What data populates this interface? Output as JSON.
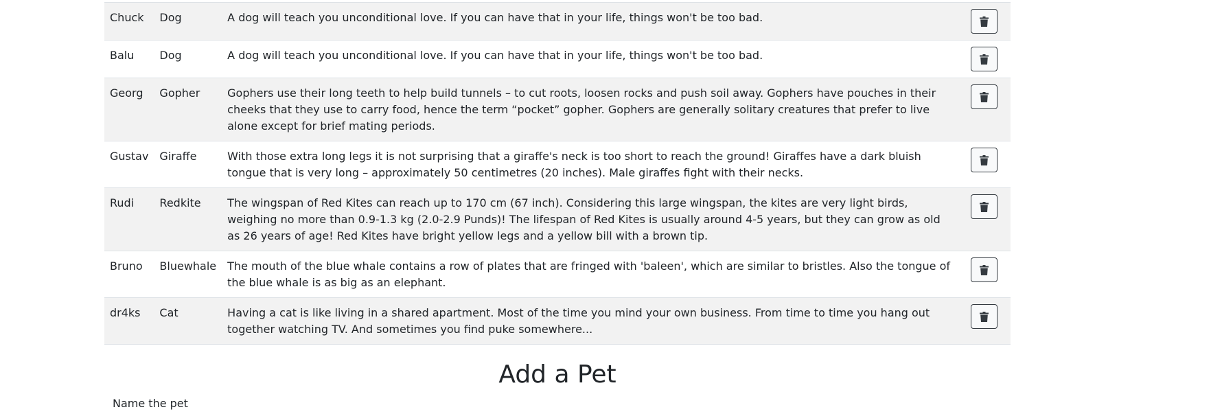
{
  "pets": [
    {
      "name": "Chuck",
      "type": "Dog",
      "description": "A dog will teach you unconditional love. If you can have that in your life, things won't be too bad."
    },
    {
      "name": "Balu",
      "type": "Dog",
      "description": "A dog will teach you unconditional love. If you can have that in your life, things won't be too bad."
    },
    {
      "name": "Georg",
      "type": "Gopher",
      "description": "Gophers use their long teeth to help build tunnels – to cut roots, loosen rocks and push soil away. Gophers have pouches in their cheeks that they use to carry food, hence the term “pocket” gopher. Gophers are generally solitary creatures that prefer to live alone except for brief mating periods."
    },
    {
      "name": "Gustav",
      "type": "Giraffe",
      "description": "With those extra long legs it is not surprising that a giraffe's neck is too short to reach the ground! Giraffes have a dark bluish tongue that is very long – approximately 50 centimetres (20 inches). Male giraffes fight with their necks."
    },
    {
      "name": "Rudi",
      "type": "Redkite",
      "description": "The wingspan of Red Kites can reach up to 170 cm (67 inch). Considering this large wingspan, the kites are very light birds, weighing no more than 0.9-1.3 kg (2.0-2.9 Punds)! The lifespan of Red Kites is usually around 4-5 years, but they can grow as old as 26 years of age! Red Kites have bright yellow legs and a yellow bill with a brown tip."
    },
    {
      "name": "Bruno",
      "type": "Bluewhale",
      "description": "The mouth of the blue whale contains a row of plates that are fringed with 'baleen', which are similar to bristles. Also the tongue of the blue whale is as big as an elephant."
    },
    {
      "name": "dr4ks",
      "type": "Cat",
      "description": "Having a cat is like living in a shared apartment. Most of the time you mind your own business. From time to time you hang out together watching TV. And sometimes you find puke somewhere..."
    }
  ],
  "delete_icon": "trash-icon",
  "add_section": {
    "title": "Add a Pet",
    "name_label": "Name the pet"
  }
}
